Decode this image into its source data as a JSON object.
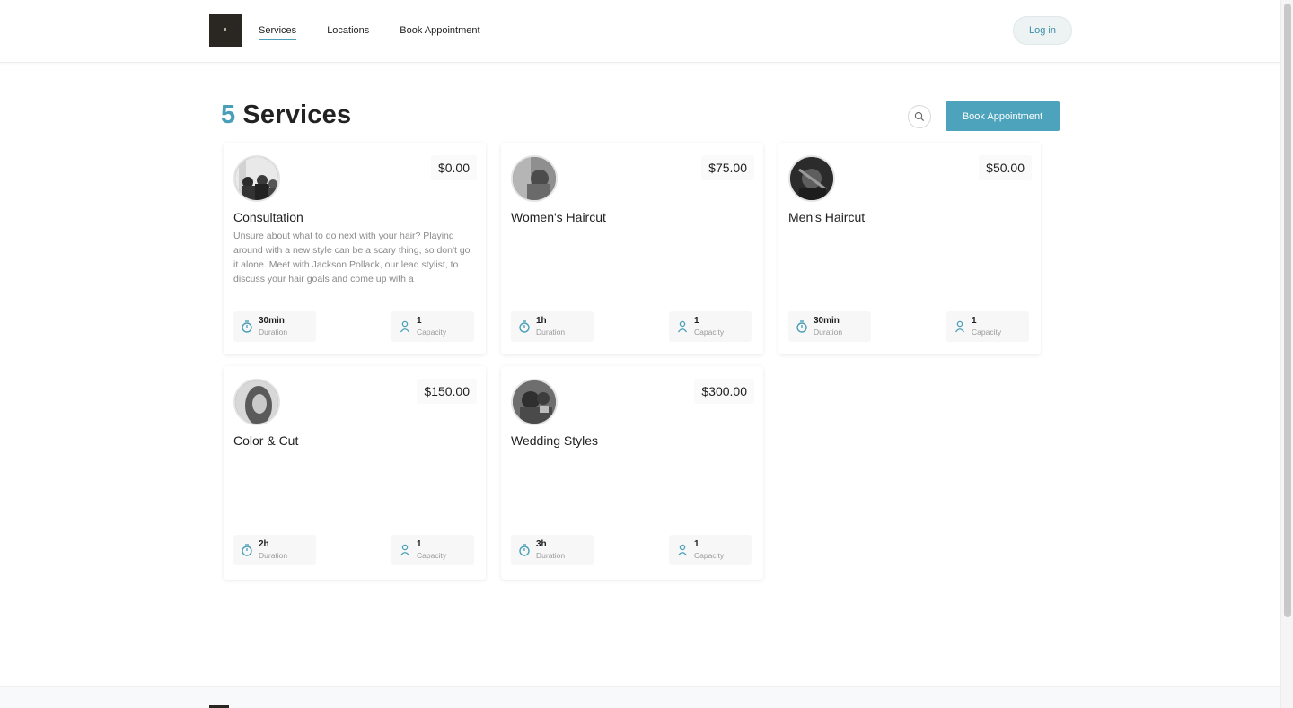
{
  "header": {
    "nav": [
      {
        "label": "Services",
        "active": true
      },
      {
        "label": "Locations",
        "active": false
      },
      {
        "label": "Book Appointment",
        "active": false
      }
    ],
    "login_label": "Log in"
  },
  "main": {
    "count": "5",
    "title": "Services",
    "book_label": "Book Appointment"
  },
  "services": [
    {
      "name": "Consultation",
      "price": "$0.00",
      "description": "Unsure about what to do next with your hair? Playing around with a new style can be a scary thing, so don't go it alone. Meet with Jackson Pollack, our lead stylist, to discuss your hair goals and come up with a",
      "duration": "30min",
      "duration_label": "Duration",
      "capacity": "1",
      "capacity_label": "Capacity"
    },
    {
      "name": "Women's Haircut",
      "price": "$75.00",
      "description": "",
      "duration": "1h",
      "duration_label": "Duration",
      "capacity": "1",
      "capacity_label": "Capacity"
    },
    {
      "name": "Men's Haircut",
      "price": "$50.00",
      "description": "",
      "duration": "30min",
      "duration_label": "Duration",
      "capacity": "1",
      "capacity_label": "Capacity"
    },
    {
      "name": "Color & Cut",
      "price": "$150.00",
      "description": "",
      "duration": "2h",
      "duration_label": "Duration",
      "capacity": "1",
      "capacity_label": "Capacity"
    },
    {
      "name": "Wedding Styles",
      "price": "$300.00",
      "description": "",
      "duration": "3h",
      "duration_label": "Duration",
      "capacity": "1",
      "capacity_label": "Capacity"
    }
  ],
  "colors": {
    "accent": "#4a9fb8",
    "button": "#4da3bb",
    "login_bg": "#edf2f3"
  },
  "icons": {
    "duration": "stopwatch-icon",
    "capacity": "person-icon",
    "search": "search-icon"
  }
}
